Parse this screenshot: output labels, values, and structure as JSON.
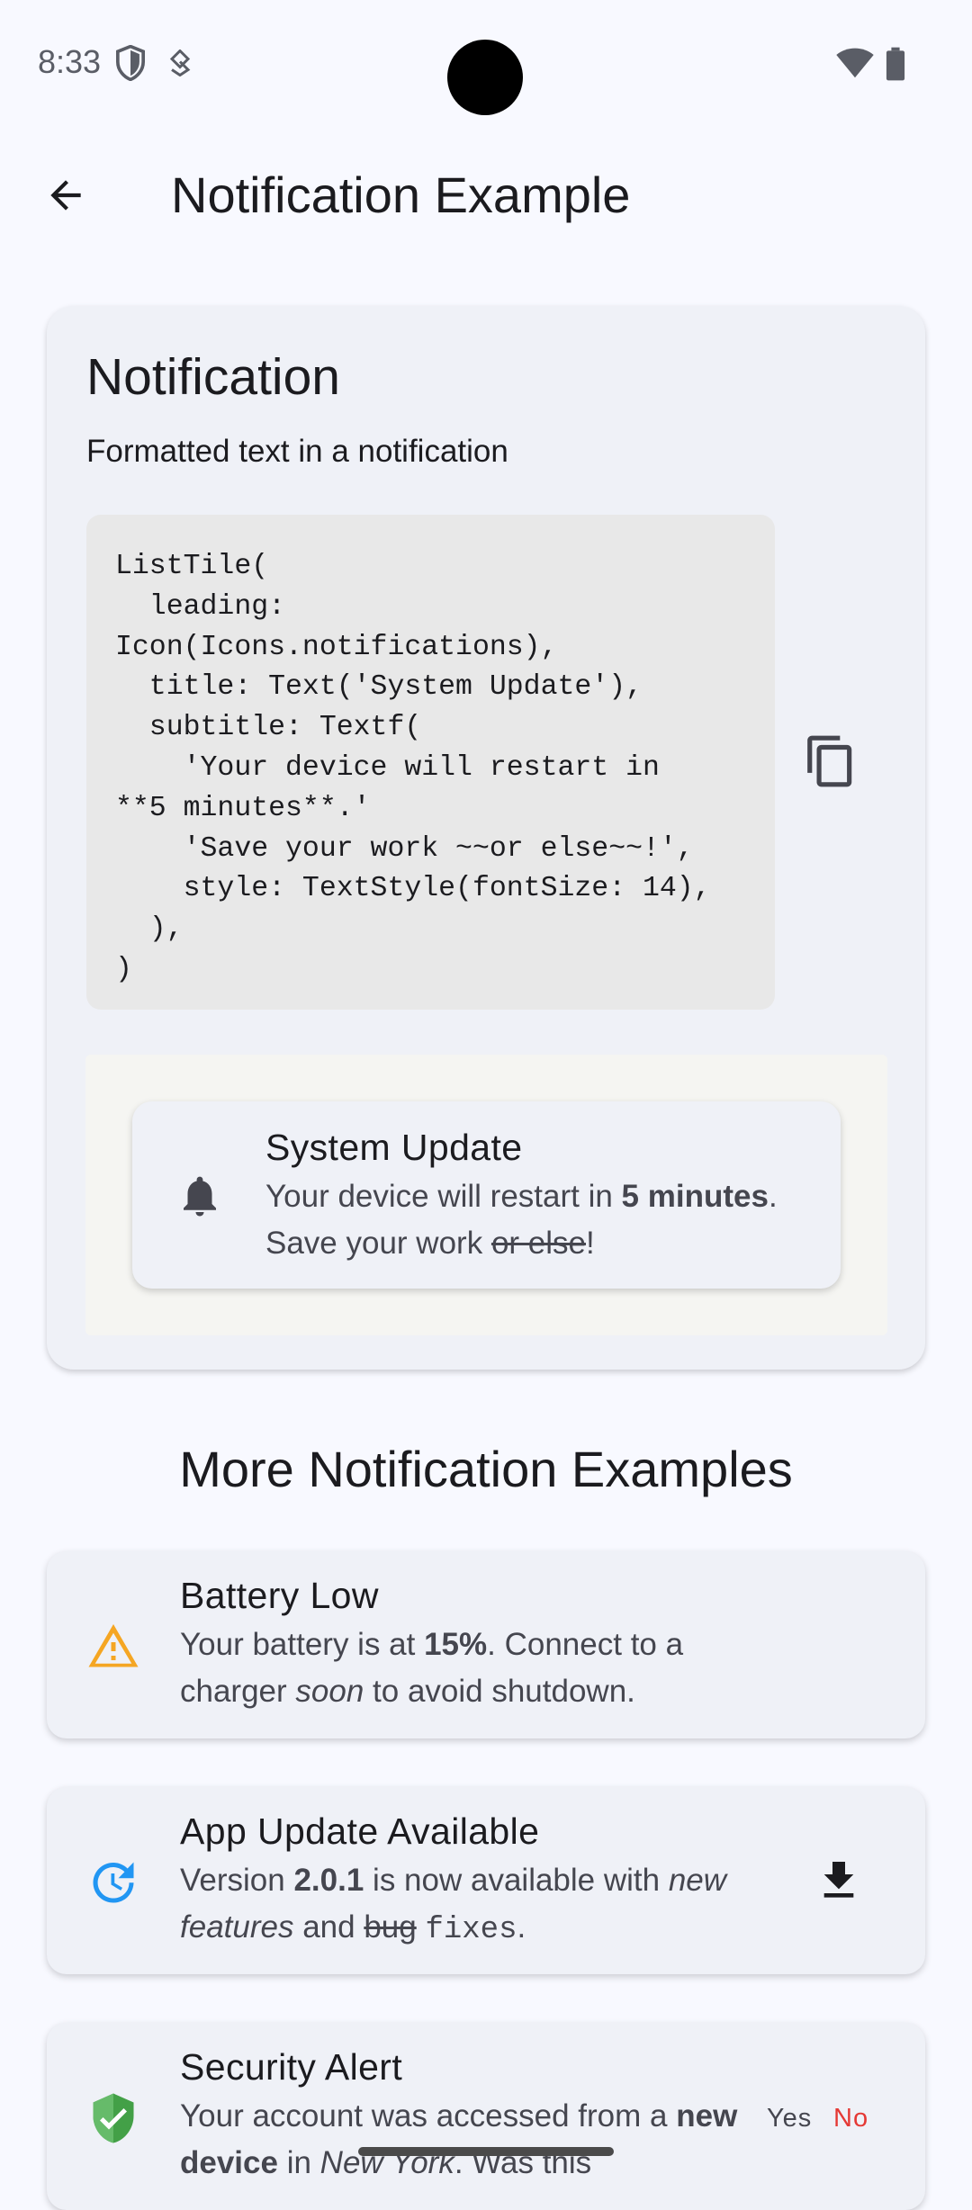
{
  "status_bar": {
    "time": "8:33"
  },
  "app_bar": {
    "title": "Notification Example"
  },
  "main_card": {
    "title": "Notification",
    "description": "Formatted text in a notification",
    "code": "ListTile(\n  leading:\nIcon(Icons.notifications),\n  title: Text('System Update'),\n  subtitle: Textf(\n    'Your device will restart in\n**5 minutes**.'\n    'Save your work ~~or else~~!',\n    style: TextStyle(fontSize: 14),\n  ),\n)",
    "preview": {
      "title": "System Update",
      "sub_1": "Your device will restart in ",
      "sub_bold": "5 minutes",
      "sub_2": ". Save your work ",
      "sub_strike": "or else",
      "sub_3": "!"
    }
  },
  "section_title": "More Notification Examples",
  "examples": {
    "battery": {
      "title": "Battery Low",
      "sub_1": "Your battery is at ",
      "sub_bold": "15%",
      "sub_2": ". Connect to a charger ",
      "sub_italic": "soon",
      "sub_3": " to avoid shutdown."
    },
    "app_update": {
      "title": "App Update Available",
      "sub_1": "Version ",
      "sub_bold": "2.0.1",
      "sub_2": " is now available with ",
      "sub_italic": "new features",
      "sub_3": " and ",
      "sub_strike": "bug",
      "sub_4": " ",
      "sub_code": "fixes",
      "sub_5": "."
    },
    "security": {
      "title": "Security Alert",
      "sub_1": "Your account was accessed from a ",
      "sub_bold": "new device",
      "sub_2": " in ",
      "sub_italic": "New York",
      "sub_3": ". Was this",
      "yes_label": "Yes",
      "no_label": "No"
    }
  },
  "colors": {
    "background": "#f8f9ff",
    "card": "#eff1f7",
    "warning": "#f5a623",
    "update_blue": "#2196f3",
    "shield_green": "#43a047",
    "no_red": "#e53935"
  },
  "icons": {
    "back": "arrow-back-icon",
    "copy": "copy-icon",
    "notification": "bell-icon",
    "battery": "warning-icon",
    "app_update": "update-icon",
    "download": "download-icon",
    "security": "shield-check-icon"
  }
}
